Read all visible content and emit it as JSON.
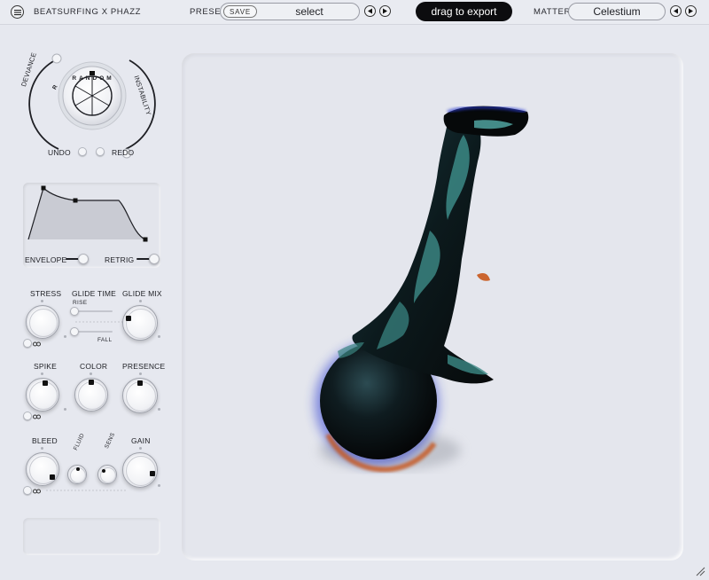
{
  "header": {
    "brand": "BEATSURFING X PHAZZ",
    "preset_label": "PRESET",
    "save_label": "SAVE",
    "preset_name": "select",
    "export_label": "drag to export",
    "matter_label": "MATTER",
    "matter_name": "Celestium"
  },
  "randomizer": {
    "left_label": "DEVIANCE",
    "right_label": "INSTABILITY",
    "dial_text": "RANDOM",
    "deviance_value": 0.85,
    "instability_value": 0.15,
    "undo_label": "UNDO",
    "redo_label": "REDO"
  },
  "envelope": {
    "envelope_label": "ENVELOPE",
    "retrig_label": "RETRIG",
    "envelope_on": true,
    "retrig_on": true
  },
  "knobs": {
    "stress_label": "STRESS",
    "glide_time_label": "GLIDE TIME",
    "glide_mix_label": "GLIDE MIX",
    "rise_label": "RISE",
    "fall_label": "FALL",
    "spike_label": "SPIKE",
    "color_label": "COLOR",
    "presence_label": "PRESENCE",
    "bleed_label": "BLEED",
    "fluid_label": "FLUID",
    "sens_label": "SENS",
    "gain_label": "GAIN"
  },
  "colors": {
    "background": "#e6e8ef",
    "accent_dark": "#0c0c0f",
    "blob_teal": "#2f7f7f",
    "blob_dark": "#0a1214",
    "blob_rim_orange": "#c8561a",
    "blob_rim_blue": "#2a3ad0"
  },
  "icons": {
    "menu": "hamburger-icon",
    "prev": "triangle-left-icon",
    "next": "triangle-right-icon",
    "link": "chain-link-icon",
    "resize": "resize-grip-icon"
  }
}
